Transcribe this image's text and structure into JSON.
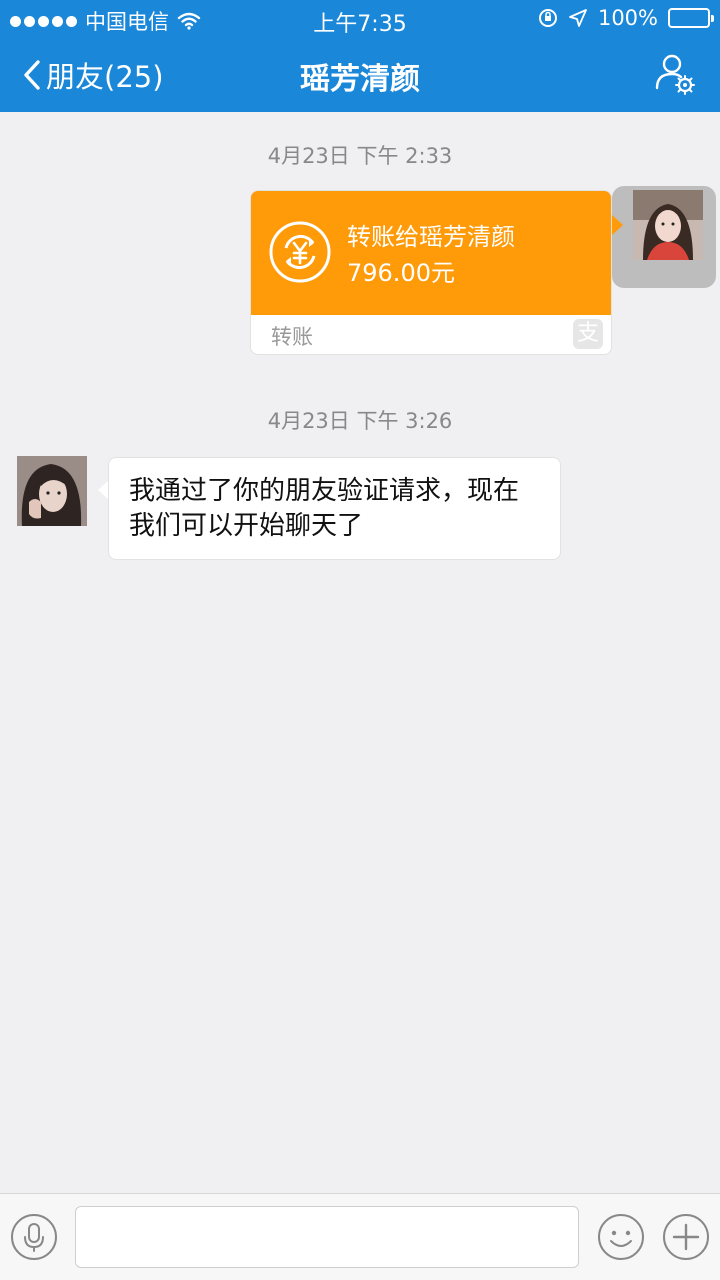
{
  "status_bar": {
    "carrier": "中国电信",
    "time": "上午7:35",
    "battery": "100%"
  },
  "nav": {
    "back_label": "朋友(25)",
    "title": "瑶芳清颜"
  },
  "messages": {
    "timestamp_1": "4月23日 下午 2:33",
    "transfer": {
      "title": "转账给瑶芳清颜",
      "amount": "796.00元",
      "type_label": "转账"
    },
    "timestamp_2": "4月23日 下午 3:26",
    "text_message": "我通过了你的朋友验证请求，现在我们可以开始聊天了"
  },
  "input": {
    "placeholder": ""
  },
  "colors": {
    "header": "#1a87d8",
    "transfer": "#ff9a09",
    "background": "#f0f0f2"
  }
}
